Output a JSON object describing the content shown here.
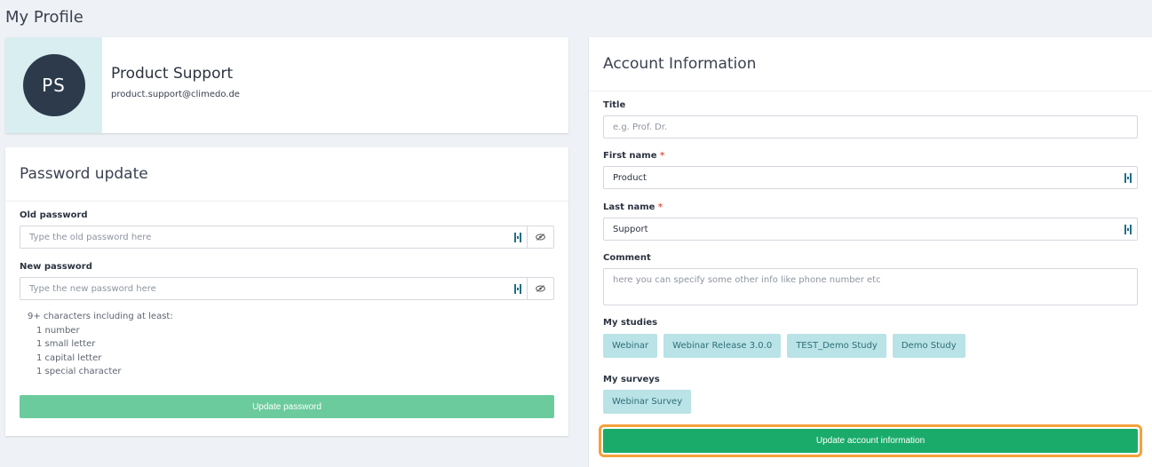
{
  "page": {
    "title": "My Profile"
  },
  "profile": {
    "initials": "PS",
    "name": "Product Support",
    "email": "product.support@climedo.de"
  },
  "password": {
    "header": "Password update",
    "old_label": "Old password",
    "old_placeholder": "Type the old password here",
    "new_label": "New password",
    "new_placeholder": "Type the new password here",
    "requirements_intro": "9+ characters including at least:",
    "requirements": [
      "1 number",
      "1 small letter",
      "1 capital letter",
      "1 special character"
    ],
    "button_label": "Update password"
  },
  "account": {
    "header": "Account Information",
    "title_label": "Title",
    "title_placeholder": "e.g. Prof. Dr.",
    "first_name_label": "First name",
    "first_name_value": "Product",
    "last_name_label": "Last name",
    "last_name_value": "Support",
    "required_marker": "*",
    "comment_label": "Comment",
    "comment_placeholder": "here you can specify some other info like phone number etc",
    "studies_label": "My studies",
    "studies": [
      "Webinar",
      "Webinar Release 3.0.0",
      "TEST_Demo Study",
      "Demo Study"
    ],
    "surveys_label": "My surveys",
    "surveys": [
      "Webinar Survey"
    ],
    "button_label": "Update account information"
  },
  "colors": {
    "page_bg": "#eef1f5",
    "avatar_bg": "#2c3a4b",
    "avatar_panel": "#d9eef0",
    "password_button": "#6bcb9d",
    "account_button": "#1aab6a",
    "highlight": "#f4a13a",
    "tag_bg": "#b9e3e6",
    "required": "#e25a4c"
  },
  "icons": {
    "password_manager": "lastpass-icon",
    "visibility_toggle": "eye-slash-icon"
  }
}
